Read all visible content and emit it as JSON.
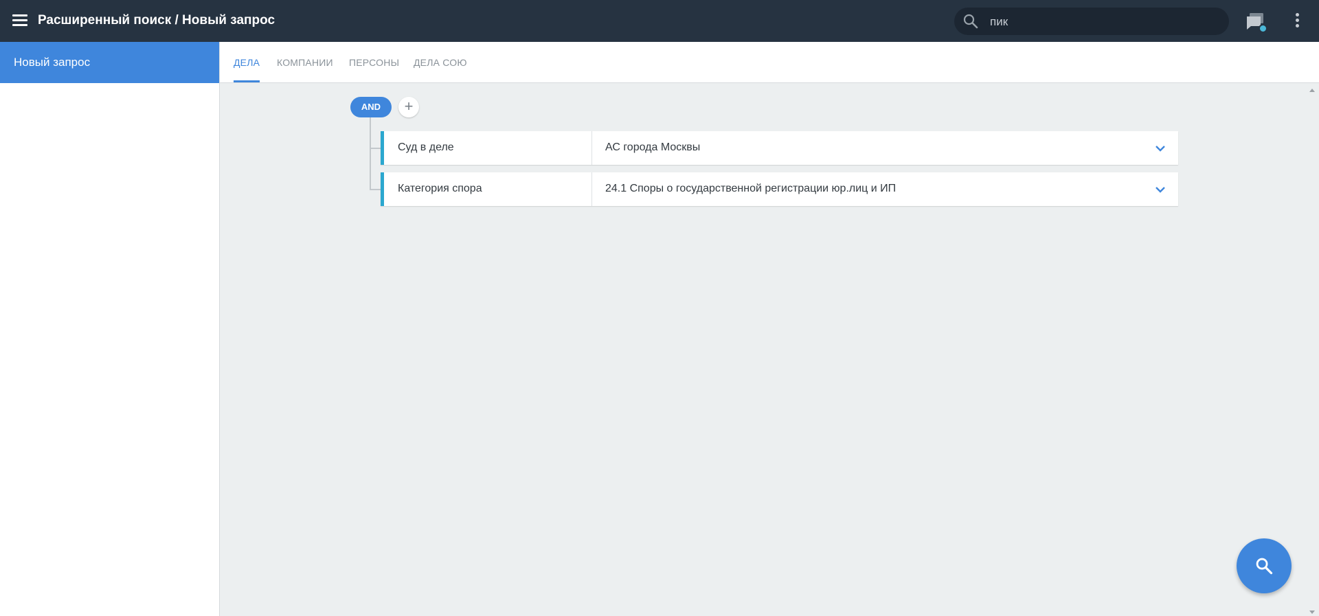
{
  "header": {
    "title": "Расширенный поиск / Новый запрос",
    "menu_icon": "hamburger-icon",
    "search": {
      "value": "пик",
      "icon": "search-icon"
    },
    "chat_icon": "chat-icon",
    "more_icon": "more-vert-icon"
  },
  "sidebar": {
    "items": [
      {
        "label": "Новый запрос",
        "active": true
      }
    ]
  },
  "tabs": [
    {
      "label": "ДЕЛА",
      "active": true
    },
    {
      "label": "КОМПАНИИ",
      "active": false
    },
    {
      "label": "ПЕРСОНЫ",
      "active": false
    },
    {
      "label": "ДЕЛА СОЮ",
      "active": false
    }
  ],
  "query": {
    "operator": "AND",
    "add_label": "+",
    "conditions": [
      {
        "field": "Суд в деле",
        "value": "АС города Москвы"
      },
      {
        "field": "Категория спора",
        "value": "24.1 Споры о государственной регистрации юр.лиц и ИП"
      }
    ]
  },
  "fab": {
    "icon": "search-icon"
  },
  "colors": {
    "topbar": "#263341",
    "accent": "#3f86dc",
    "condition_marker": "#2ba7cf",
    "content_bg": "#eceff0"
  }
}
